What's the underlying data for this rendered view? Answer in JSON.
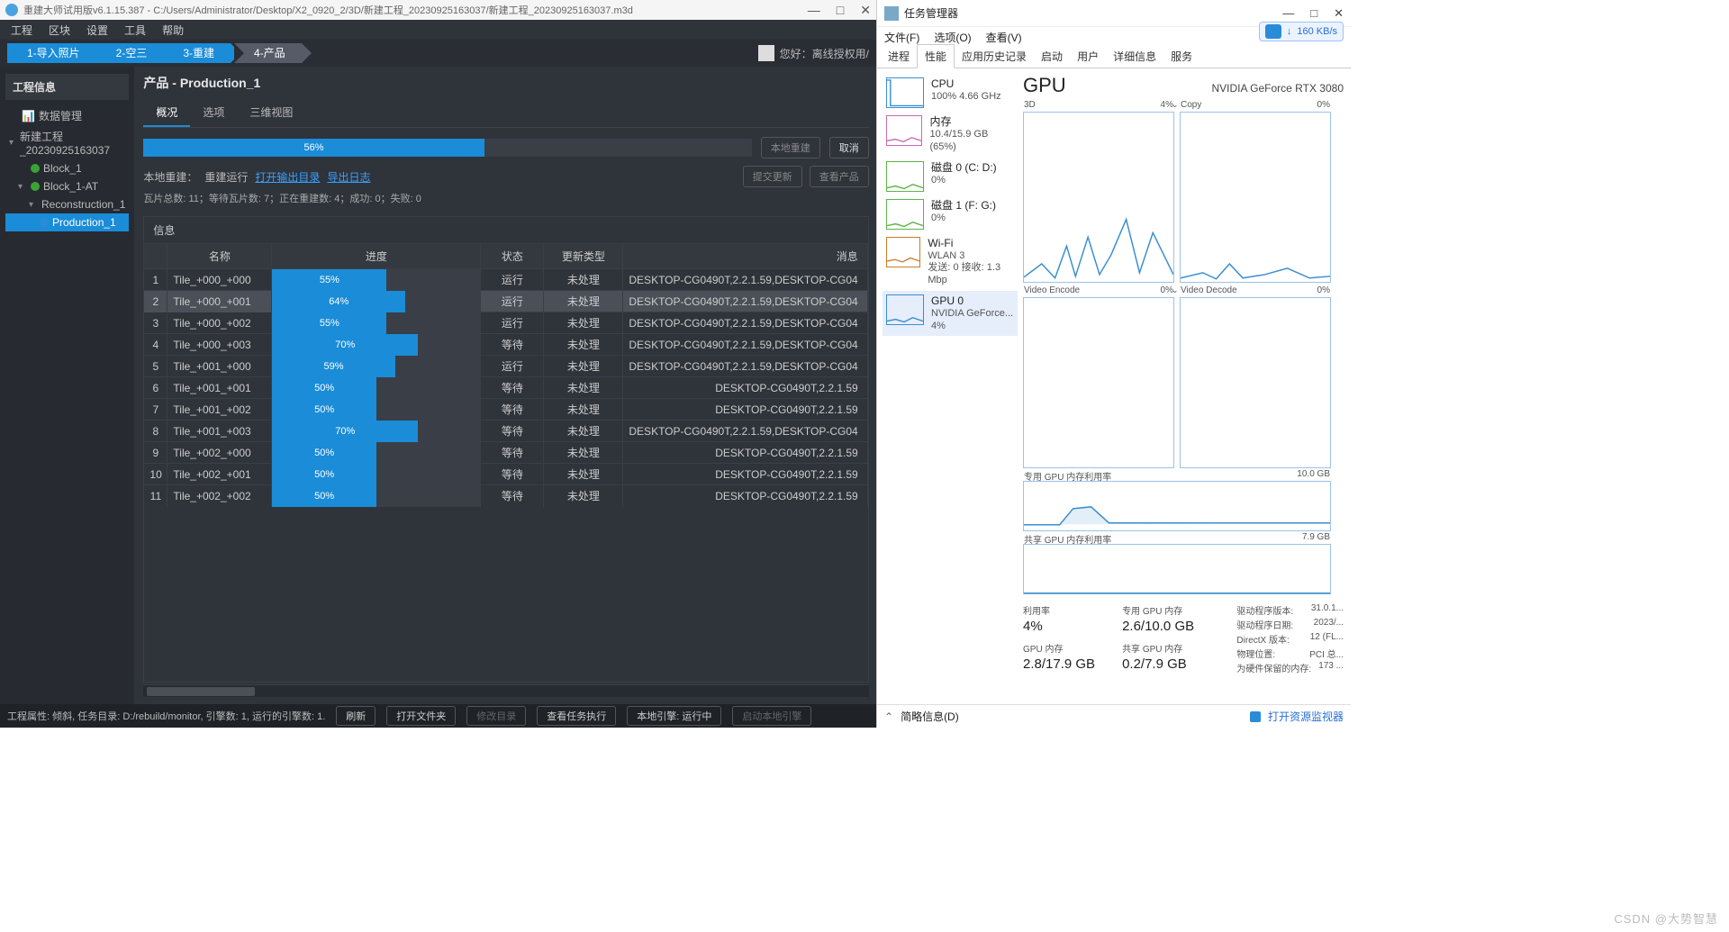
{
  "left": {
    "title": "重建大师试用版v6.1.15.387 - C:/Users/Administrator/Desktop/X2_0920_2/3D/新建工程_20230925163037/新建工程_20230925163037.m3d",
    "menus": [
      "工程",
      "区块",
      "设置",
      "工具",
      "帮助"
    ],
    "steps": [
      "1-导入照片",
      "2-空三",
      "3-重建",
      "4-产品"
    ],
    "user_label": "您好：离线授权用/",
    "sidebar_title": "工程信息",
    "tree": {
      "root": "数据管理",
      "project": "新建工程_20230925163037",
      "block1": "Block_1",
      "block1at": "Block_1-AT",
      "recon": "Reconstruction_1",
      "prod": "Production_1"
    },
    "main_title": "产品 - Production_1",
    "tabs": [
      "概况",
      "选项",
      "三维视图"
    ],
    "progress_pct": 56,
    "btn_local_rebuild": "本地重建",
    "btn_cancel": "取消",
    "btn_submit": "提交更新",
    "btn_view_prod": "查看产品",
    "status_prefix": "本地重建：",
    "status_state": "重建运行",
    "link_open_out": "打开输出目录",
    "link_export_log": "导出日志",
    "counts": "瓦片总数: 11；等待瓦片数: 7；正在重建数: 4；成功: 0；失败: 0",
    "table_title": "信息",
    "cols": {
      "name": "名称",
      "progress": "进度",
      "state": "状态",
      "update": "更新类型",
      "msg": "消息"
    },
    "rows": [
      {
        "name": "Tile_+000_+000",
        "pct": 55,
        "state": "运行",
        "upd": "未处理",
        "msg": "DESKTOP-CG0490T,2.2.1.59,DESKTOP-CG04"
      },
      {
        "name": "Tile_+000_+001",
        "pct": 64,
        "state": "运行",
        "upd": "未处理",
        "msg": "DESKTOP-CG0490T,2.2.1.59,DESKTOP-CG04"
      },
      {
        "name": "Tile_+000_+002",
        "pct": 55,
        "state": "运行",
        "upd": "未处理",
        "msg": "DESKTOP-CG0490T,2.2.1.59,DESKTOP-CG04"
      },
      {
        "name": "Tile_+000_+003",
        "pct": 70,
        "state": "等待",
        "upd": "未处理",
        "msg": "DESKTOP-CG0490T,2.2.1.59,DESKTOP-CG04"
      },
      {
        "name": "Tile_+001_+000",
        "pct": 59,
        "state": "运行",
        "upd": "未处理",
        "msg": "DESKTOP-CG0490T,2.2.1.59,DESKTOP-CG04"
      },
      {
        "name": "Tile_+001_+001",
        "pct": 50,
        "state": "等待",
        "upd": "未处理",
        "msg": "DESKTOP-CG0490T,2.2.1.59"
      },
      {
        "name": "Tile_+001_+002",
        "pct": 50,
        "state": "等待",
        "upd": "未处理",
        "msg": "DESKTOP-CG0490T,2.2.1.59"
      },
      {
        "name": "Tile_+001_+003",
        "pct": 70,
        "state": "等待",
        "upd": "未处理",
        "msg": "DESKTOP-CG0490T,2.2.1.59,DESKTOP-CG04"
      },
      {
        "name": "Tile_+002_+000",
        "pct": 50,
        "state": "等待",
        "upd": "未处理",
        "msg": "DESKTOP-CG0490T,2.2.1.59"
      },
      {
        "name": "Tile_+002_+001",
        "pct": 50,
        "state": "等待",
        "upd": "未处理",
        "msg": "DESKTOP-CG0490T,2.2.1.59"
      },
      {
        "name": "Tile_+002_+002",
        "pct": 50,
        "state": "等待",
        "upd": "未处理",
        "msg": "DESKTOP-CG0490T,2.2.1.59"
      }
    ],
    "statusbar": {
      "proj_attr": "工程属性: 倾斜, 任务目录: D:/rebuild/monitor, 引擎数: 1, 运行的引擎数: 1.",
      "b_refresh": "刷新",
      "b_openfolder": "打开文件夹",
      "b_editdir": "修改目录",
      "b_viewtask": "查看任务执行",
      "b_localengine": "本地引擎: 运行中",
      "b_startlocal": "启动本地引擎"
    }
  },
  "right": {
    "title": "任务管理器",
    "menus": [
      "文件(F)",
      "选项(O)",
      "查看(V)"
    ],
    "tabs": [
      "进程",
      "性能",
      "应用历史记录",
      "启动",
      "用户",
      "详细信息",
      "服务"
    ],
    "speed": "160 KB/s",
    "side": [
      {
        "title": "CPU",
        "sub": "100%  4.66 GHz",
        "color": "#3a8ed0"
      },
      {
        "title": "内存",
        "sub": "10.4/15.9 GB (65%)",
        "color": "#c76bb5"
      },
      {
        "title": "磁盘 0 (C: D:)",
        "sub": "0%",
        "color": "#5fb34a"
      },
      {
        "title": "磁盘 1 (F: G:)",
        "sub": "0%",
        "color": "#5fb34a"
      },
      {
        "title": "Wi-Fi",
        "sub": "WLAN 3",
        "sub2": "发送: 0 接收: 1.3 Mbp",
        "color": "#cc7a2a"
      },
      {
        "title": "GPU 0",
        "sub": "NVIDIA GeForce...",
        "sub2": "4%",
        "color": "#3a8ed0"
      }
    ],
    "gpu": {
      "heading": "GPU",
      "device": "NVIDIA GeForce RTX 3080",
      "charts": {
        "c3d": {
          "label": "3D",
          "pct": "4%"
        },
        "copy": {
          "label": "Copy",
          "pct": "0%"
        },
        "venc": {
          "label": "Video Encode",
          "pct": "0%"
        },
        "vdec": {
          "label": "Video Decode",
          "pct": "0%"
        }
      },
      "mem_dedicated": {
        "label": "专用 GPU 内存利用率",
        "max": "10.0 GB"
      },
      "mem_shared": {
        "label": "共享 GPU 内存利用率",
        "max": "7.9 GB"
      },
      "stats": {
        "util_k": "利用率",
        "util_v": "4%",
        "ded_k": "专用 GPU 内存",
        "ded_v": "2.6/10.0 GB",
        "gpu_k": "GPU 内存",
        "gpu_v": "2.8/17.9 GB",
        "shr_k": "共享 GPU 内存",
        "shr_v": "0.2/7.9 GB"
      },
      "driver": {
        "ver_k": "驱动程序版本:",
        "ver_v": "31.0.1...",
        "date_k": "驱动程序日期:",
        "date_v": "2023/...",
        "dx_k": "DirectX  版本:",
        "dx_v": "12 (FL...",
        "loc_k": "物理位置:",
        "loc_v": "PCI 总...",
        "res_k": "为硬件保留的内存:",
        "res_v": "173 ..."
      }
    },
    "status": {
      "brief": "简略信息(D)",
      "open_mon": "打开资源监视器"
    }
  },
  "watermark": "CSDN @大势智慧"
}
